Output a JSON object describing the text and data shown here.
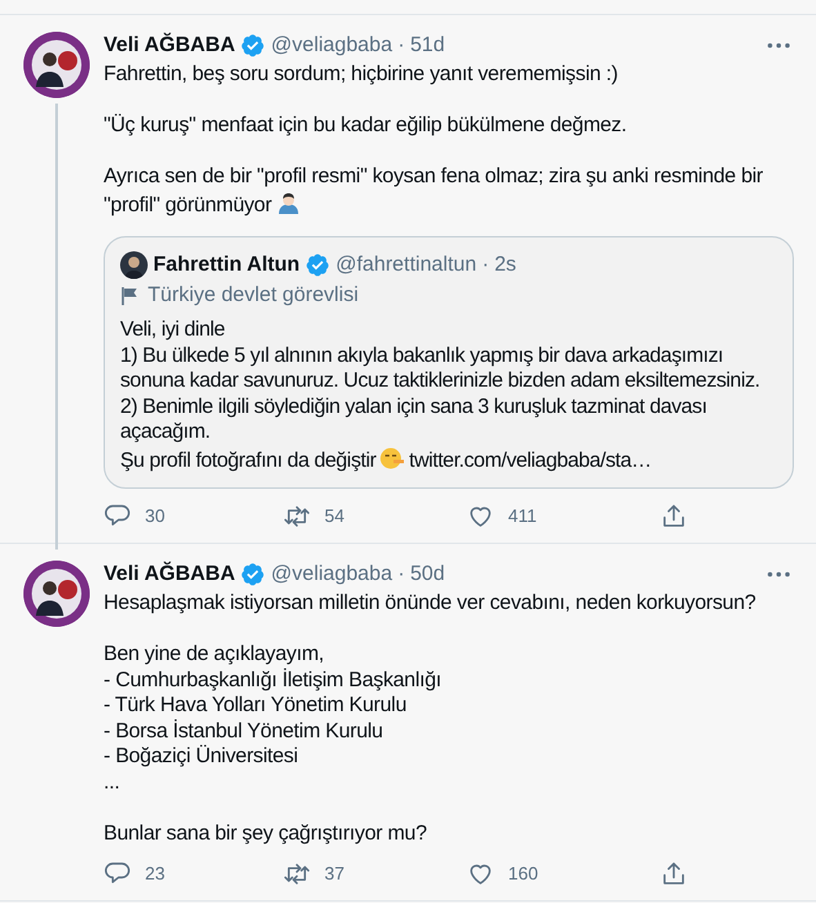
{
  "tweets": [
    {
      "author": {
        "name": "Veli AĞBABA",
        "verified": true,
        "handle": "@veliagbaba",
        "dot": "·",
        "time": "51d"
      },
      "thread_line": true,
      "paragraphs": [
        {
          "lines": [
            {
              "text": "Fahrettin, beş soru sordum; hiçbirine yanıt verememişsin :)"
            }
          ]
        },
        {
          "lines": [
            {
              "text": "\"Üç kuruş\" menfaat için bu kadar eğilip bükülmene değmez."
            }
          ]
        },
        {
          "lines": [
            {
              "text": "Ayrıca sen de bir \"profil resmi\" koysan fena olmaz; zira şu anki resminde bir"
            },
            {
              "text": "\"profil\" görünmüyor",
              "kind": "person"
            }
          ]
        }
      ],
      "quote": {
        "author": {
          "name": "Fahrettin Altun",
          "verified": true,
          "handle": "@fahrettinaltun",
          "dot": "·",
          "time": "2s"
        },
        "label": "Türkiye devlet görevlisi",
        "lines": [
          {
            "text": "Veli, iyi dinle"
          },
          {
            "text": "1) Bu ülkede 5 yıl alnının akıyla bakanlık yapmış bir dava arkadaşımızı sonuna kadar savunuruz. Ucuz taktiklerinizle bizden adam eksiltemezsiniz."
          },
          {
            "text": "2) Benimle ilgili söylediğin yalan için sana 3 kuruşluk tazminat davası açacağım."
          },
          {
            "text": "Şu profil fotoğrafını da değiştir",
            "kind": "face",
            "link": "twitter.com/veliagbaba/sta…"
          }
        ]
      },
      "actions": {
        "replies": "30",
        "retweets": "54",
        "likes": "411"
      }
    },
    {
      "author": {
        "name": "Veli AĞBABA",
        "verified": true,
        "handle": "@veliagbaba",
        "dot": "·",
        "time": "50d"
      },
      "thread_line": false,
      "paragraphs": [
        {
          "lines": [
            {
              "text": "Hesaplaşmak istiyorsan milletin önünde ver cevabını, neden korkuyorsun?"
            }
          ]
        },
        {
          "lines": [
            {
              "text": "Ben yine de açıklayayım,"
            },
            {
              "text": "- Cumhurbaşkanlığı İletişim Başkanlığı"
            },
            {
              "text": "- Türk Hava Yolları Yönetim Kurulu"
            },
            {
              "text": "- Borsa İstanbul Yönetim Kurulu"
            },
            {
              "text": "- Boğaziçi Üniversitesi"
            },
            {
              "text": "..."
            }
          ]
        },
        {
          "lines": [
            {
              "text": "Bunlar sana bir şey çağrıştırıyor mu?"
            }
          ]
        }
      ],
      "actions": {
        "replies": "23",
        "retweets": "37",
        "likes": "160"
      }
    }
  ]
}
